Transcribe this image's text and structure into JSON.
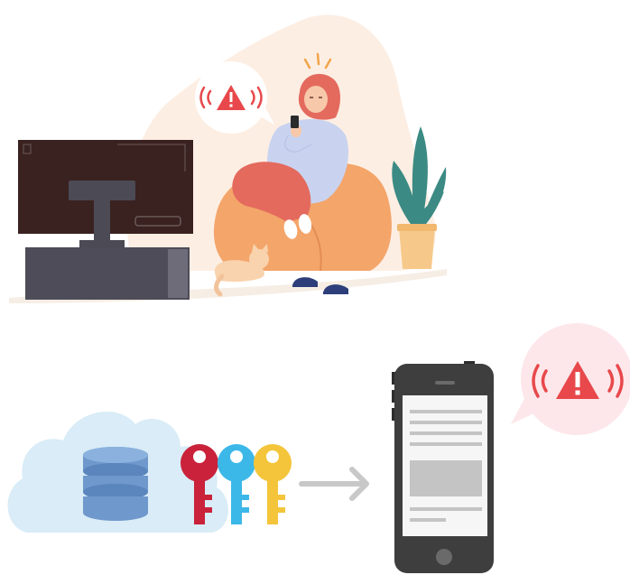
{
  "colors": {
    "background": "#ffffff",
    "blob": "#fdeee3",
    "alert_red": "#e8484b",
    "alert_bubble": "#fde7ea",
    "tv_screen": "#3a2220",
    "tv_stand": "#4c4a55",
    "cabinet": "#4d4c58",
    "beanbag": "#f4a56a",
    "pants": "#e46a5e",
    "sweater": "#c9d3f0",
    "hair": "#e46a5e",
    "skin": "#f8c8aa",
    "plant": "#3c8a84",
    "pot": "#f6c98a",
    "cat": "#f8d3ad",
    "slippers": "#2d3e7a",
    "cloud": "#d9ecf7",
    "database": "#6f98cc",
    "key_red": "#c9223a",
    "key_blue": "#3cb8e8",
    "key_yellow": "#f4c53a",
    "arrow": "#c8c8c8",
    "phone_body": "#3e3e3e",
    "phone_screen": "#f6f6f6",
    "phone_lines": "#c4c4c4"
  },
  "icons": {
    "alert_top": "alert-triangle-icon",
    "alert_bottom": "alert-triangle-icon",
    "database": "database-icon",
    "keys": [
      "key-icon",
      "key-icon",
      "key-icon"
    ],
    "arrow": "arrow-right-icon"
  }
}
